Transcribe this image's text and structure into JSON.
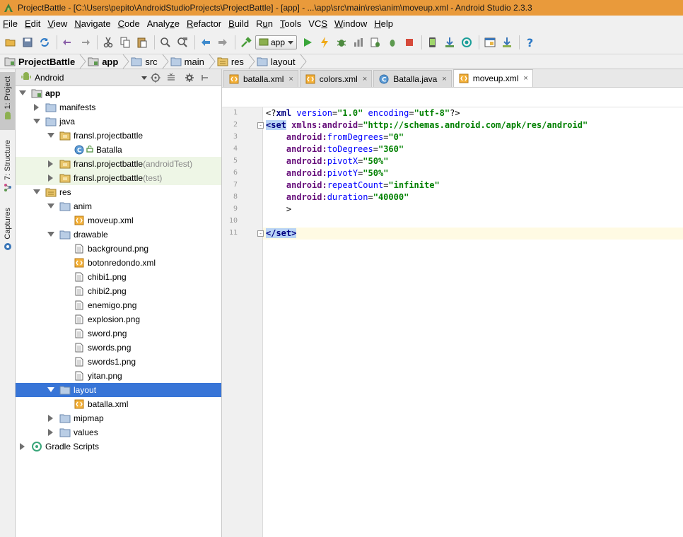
{
  "window": {
    "title": "ProjectBattle - [C:\\Users\\pepito\\AndroidStudioProjects\\ProjectBattle] - [app] - ...\\app\\src\\main\\res\\anim\\moveup.xml - Android Studio 2.3.3"
  },
  "menu": [
    {
      "pre": "",
      "u": "F",
      "post": "ile"
    },
    {
      "pre": "",
      "u": "E",
      "post": "dit"
    },
    {
      "pre": "",
      "u": "V",
      "post": "iew"
    },
    {
      "pre": "",
      "u": "N",
      "post": "avigate"
    },
    {
      "pre": "",
      "u": "C",
      "post": "ode"
    },
    {
      "pre": "Analy",
      "u": "z",
      "post": "e"
    },
    {
      "pre": "",
      "u": "R",
      "post": "efactor"
    },
    {
      "pre": "",
      "u": "B",
      "post": "uild"
    },
    {
      "pre": "R",
      "u": "u",
      "post": "n"
    },
    {
      "pre": "",
      "u": "T",
      "post": "ools"
    },
    {
      "pre": "VC",
      "u": "S",
      "post": ""
    },
    {
      "pre": "",
      "u": "W",
      "post": "indow"
    },
    {
      "pre": "",
      "u": "H",
      "post": "elp"
    }
  ],
  "toolbar": {
    "run_config": "app",
    "icons": [
      "open-folder-icon",
      "save-icon",
      "sync-icon",
      "undo-icon",
      "redo-icon",
      "cut-icon",
      "copy-icon",
      "paste-icon",
      "find-icon",
      "replace-icon",
      "back-icon",
      "forward-icon",
      "make-project-icon",
      "run-config",
      "run-icon",
      "apply-changes-icon",
      "debug-icon",
      "profile-icon",
      "attach-debugger-icon",
      "stop-icon",
      "avd-manager-icon",
      "sdk-manager-icon",
      "project-structure-icon",
      "gradle-sync-icon",
      "help-icon"
    ]
  },
  "breadcrumb": [
    {
      "label": "ProjectBattle",
      "bold": true,
      "icon": "project-folder-icon"
    },
    {
      "label": "app",
      "bold": true,
      "icon": "module-folder-icon"
    },
    {
      "label": "src",
      "bold": false,
      "icon": "folder-icon"
    },
    {
      "label": "main",
      "bold": false,
      "icon": "folder-icon"
    },
    {
      "label": "res",
      "bold": false,
      "icon": "res-folder-icon"
    },
    {
      "label": "layout",
      "bold": false,
      "icon": "folder-icon"
    }
  ],
  "side_tabs": [
    {
      "label": "1: Project",
      "icon": "android-icon"
    },
    {
      "label": "7: Structure",
      "icon": "structure-icon"
    },
    {
      "label": "Captures",
      "icon": "captures-icon"
    }
  ],
  "project_panel": {
    "view": "Android",
    "tree": [
      {
        "depth": 0,
        "toggle": "open",
        "icon": "module",
        "label": "app",
        "bold": true
      },
      {
        "depth": 1,
        "toggle": "closed",
        "icon": "folder",
        "label": "manifests"
      },
      {
        "depth": 1,
        "toggle": "open",
        "icon": "folder",
        "label": "java"
      },
      {
        "depth": 2,
        "toggle": "open",
        "icon": "package",
        "label": "fransl.projectbattle"
      },
      {
        "depth": 3,
        "toggle": "none",
        "icon": "class",
        "label": "Batalla"
      },
      {
        "depth": 2,
        "toggle": "closed",
        "icon": "package",
        "label": "fransl.projectbattle",
        "sub": "(androidTest)",
        "hl": true
      },
      {
        "depth": 2,
        "toggle": "closed",
        "icon": "package",
        "label": "fransl.projectbattle",
        "sub": "(test)",
        "hl": true
      },
      {
        "depth": 1,
        "toggle": "open",
        "icon": "res",
        "label": "res"
      },
      {
        "depth": 2,
        "toggle": "open",
        "icon": "folder",
        "label": "anim"
      },
      {
        "depth": 3,
        "toggle": "none",
        "icon": "xml",
        "label": "moveup.xml"
      },
      {
        "depth": 2,
        "toggle": "open",
        "icon": "folder",
        "label": "drawable"
      },
      {
        "depth": 3,
        "toggle": "none",
        "icon": "image",
        "label": "background.png"
      },
      {
        "depth": 3,
        "toggle": "none",
        "icon": "xml",
        "label": "botonredondo.xml"
      },
      {
        "depth": 3,
        "toggle": "none",
        "icon": "image",
        "label": "chibi1.png"
      },
      {
        "depth": 3,
        "toggle": "none",
        "icon": "image",
        "label": "chibi2.png"
      },
      {
        "depth": 3,
        "toggle": "none",
        "icon": "image",
        "label": "enemigo.png"
      },
      {
        "depth": 3,
        "toggle": "none",
        "icon": "image",
        "label": "explosion.png"
      },
      {
        "depth": 3,
        "toggle": "none",
        "icon": "image",
        "label": "sword.png"
      },
      {
        "depth": 3,
        "toggle": "none",
        "icon": "image",
        "label": "swords.png"
      },
      {
        "depth": 3,
        "toggle": "none",
        "icon": "image",
        "label": "swords1.png"
      },
      {
        "depth": 3,
        "toggle": "none",
        "icon": "image",
        "label": "yitan.png"
      },
      {
        "depth": 2,
        "toggle": "open",
        "icon": "folder",
        "label": "layout",
        "selected": true
      },
      {
        "depth": 3,
        "toggle": "none",
        "icon": "xml",
        "label": "batalla.xml"
      },
      {
        "depth": 2,
        "toggle": "closed",
        "icon": "folder",
        "label": "mipmap"
      },
      {
        "depth": 2,
        "toggle": "closed",
        "icon": "folder",
        "label": "values"
      },
      {
        "depth": 0,
        "toggle": "closed",
        "icon": "gradle",
        "label": "Gradle Scripts"
      }
    ]
  },
  "editor": {
    "tabs": [
      {
        "label": "batalla.xml",
        "icon": "xml",
        "active": false
      },
      {
        "label": "colors.xml",
        "icon": "xml",
        "active": false
      },
      {
        "label": "Batalla.java",
        "icon": "class",
        "active": false
      },
      {
        "label": "moveup.xml",
        "icon": "xml",
        "active": true
      }
    ],
    "close_glyph": "×",
    "current_line": 11,
    "lines": [
      [
        {
          "t": "<?",
          "c": "t-pi"
        },
        {
          "t": "xml ",
          "c": "t-tag"
        },
        {
          "t": "version",
          "c": "t-attr"
        },
        {
          "t": "=",
          "c": "t-pun"
        },
        {
          "t": "\"1.0\"",
          "c": "t-val"
        },
        {
          "t": " ",
          "c": "t-pun"
        },
        {
          "t": "encoding",
          "c": "t-attr"
        },
        {
          "t": "=",
          "c": "t-pun"
        },
        {
          "t": "\"utf-8\"",
          "c": "t-val"
        },
        {
          "t": "?>",
          "c": "t-pi"
        }
      ],
      [
        {
          "t": "<set",
          "c": "t-tag t-tagm"
        },
        {
          "t": " ",
          "c": "t-pun"
        },
        {
          "t": "xmlns:",
          "c": "t-ns"
        },
        {
          "t": "android",
          "c": "t-ns"
        },
        {
          "t": "=",
          "c": "t-pun"
        },
        {
          "t": "\"http://schemas.android.com/apk/res/android\"",
          "c": "t-val"
        }
      ],
      [
        {
          "t": "    ",
          "c": "t-pun"
        },
        {
          "t": "android:",
          "c": "t-ns"
        },
        {
          "t": "fromDegrees",
          "c": "t-nsattr"
        },
        {
          "t": "=",
          "c": "t-pun"
        },
        {
          "t": "\"0\"",
          "c": "t-val"
        }
      ],
      [
        {
          "t": "    ",
          "c": "t-pun"
        },
        {
          "t": "android:",
          "c": "t-ns"
        },
        {
          "t": "toDegrees",
          "c": "t-nsattr"
        },
        {
          "t": "=",
          "c": "t-pun"
        },
        {
          "t": "\"360\"",
          "c": "t-val"
        }
      ],
      [
        {
          "t": "    ",
          "c": "t-pun"
        },
        {
          "t": "android:",
          "c": "t-ns"
        },
        {
          "t": "pivotX",
          "c": "t-nsattr"
        },
        {
          "t": "=",
          "c": "t-pun"
        },
        {
          "t": "\"50%\"",
          "c": "t-val"
        }
      ],
      [
        {
          "t": "    ",
          "c": "t-pun"
        },
        {
          "t": "android:",
          "c": "t-ns"
        },
        {
          "t": "pivotY",
          "c": "t-nsattr"
        },
        {
          "t": "=",
          "c": "t-pun"
        },
        {
          "t": "\"50%\"",
          "c": "t-val"
        }
      ],
      [
        {
          "t": "    ",
          "c": "t-pun"
        },
        {
          "t": "android:",
          "c": "t-ns"
        },
        {
          "t": "repeatCount",
          "c": "t-nsattr"
        },
        {
          "t": "=",
          "c": "t-pun"
        },
        {
          "t": "\"infinite\"",
          "c": "t-val"
        }
      ],
      [
        {
          "t": "    ",
          "c": "t-pun"
        },
        {
          "t": "android:",
          "c": "t-ns"
        },
        {
          "t": "duration",
          "c": "t-nsattr"
        },
        {
          "t": "=",
          "c": "t-pun"
        },
        {
          "t": "\"40000\"",
          "c": "t-val"
        }
      ],
      [
        {
          "t": "    >",
          "c": "t-pun"
        }
      ],
      [],
      [
        {
          "t": "</set>",
          "c": "t-tag t-tagm"
        }
      ]
    ]
  },
  "colors": {
    "titlebar": "#e99a3b",
    "selection": "#3875d7",
    "highlight_row": "#eef6e6",
    "current_line": "#fffae3"
  }
}
